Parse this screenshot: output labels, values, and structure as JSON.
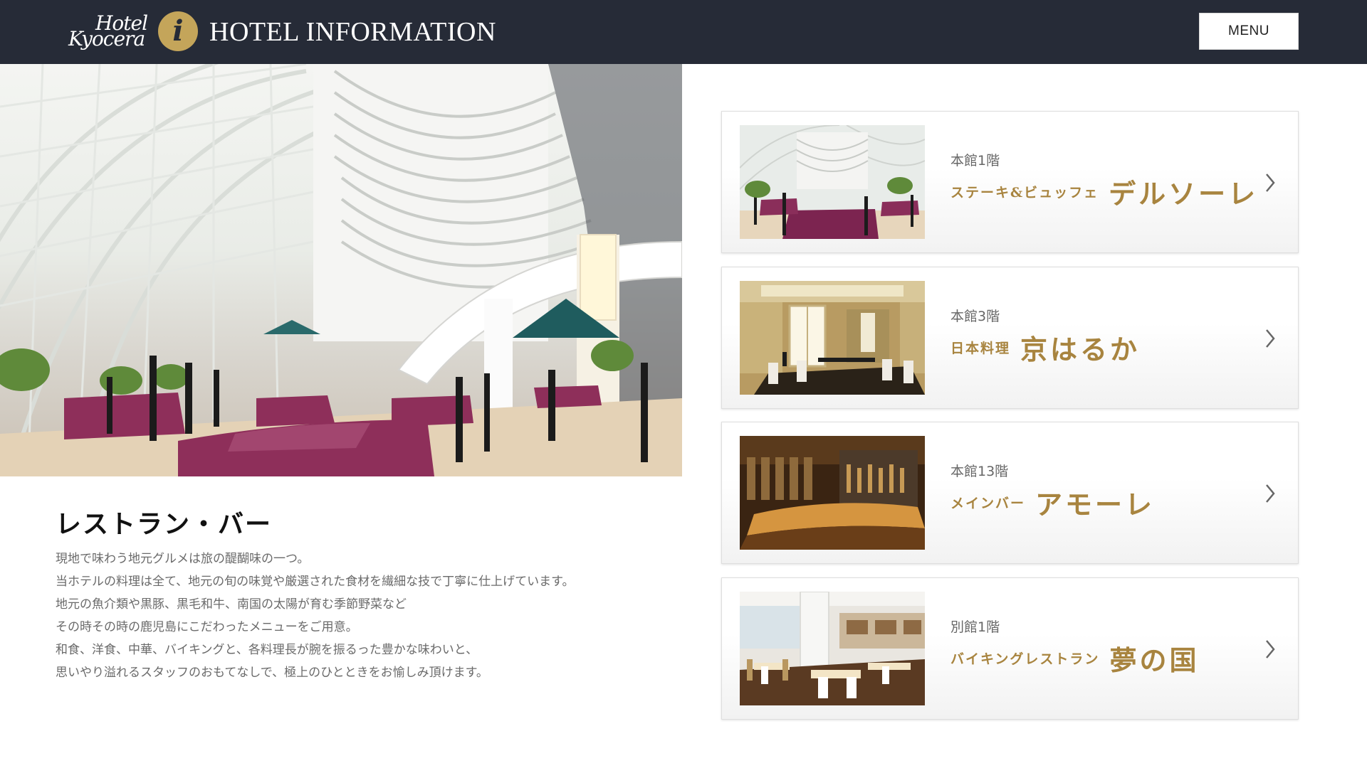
{
  "header": {
    "logo_line1": "Hotel",
    "logo_line2": "Kyocera",
    "info_icon": "i",
    "title": "HOTEL INFORMATION",
    "menu_label": "MENU"
  },
  "section": {
    "title": "レストラン・バー",
    "paragraphs": [
      "現地で味わう地元グルメは旅の醍醐味の一つ。",
      "当ホテルの料理は全て、地元の旬の味覚や厳選された食材を繊細な技で丁寧に仕上げています。",
      "地元の魚介類や黒豚、黒毛和牛、南国の太陽が育む季節野菜など",
      "その時その時の鹿児島にこだわったメニューをご用意。",
      "和食、洋食、中華、バイキングと、各料理長が腕を振るった豊かな味わいと、",
      "思いやり溢れるスタッフのおもてなしで、極上のひとときをお愉しみ頂けます。"
    ]
  },
  "restaurants": [
    {
      "floor": "本館1階",
      "category": "ステーキ&ビュッフェ",
      "name": "デルソーレ",
      "icon": "chevron-right-icon"
    },
    {
      "floor": "本館3階",
      "category": "日本料理",
      "name": "京はるか",
      "icon": "chevron-right-icon"
    },
    {
      "floor": "本館13階",
      "category": "メインバー",
      "name": "アモーレ",
      "icon": "chevron-right-icon"
    },
    {
      "floor": "別館1階",
      "category": "バイキングレストラン",
      "name": "夢の国",
      "icon": "chevron-right-icon"
    }
  ],
  "colors": {
    "header_bg": "#262b37",
    "accent_gold": "#a8843f",
    "info_icon_gold": "#c4a55a"
  }
}
